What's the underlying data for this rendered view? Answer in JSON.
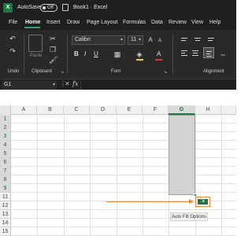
{
  "titlebar": {
    "app_letter": "X",
    "autosave_label": "AutoSave",
    "autosave_state": "Off",
    "document_title": "Book1 · Excel"
  },
  "tabs": [
    "File",
    "Home",
    "Insert",
    "Draw",
    "Page Layout",
    "Formulas",
    "Data",
    "Review",
    "View",
    "Help"
  ],
  "active_tab": "Home",
  "ribbon": {
    "groups": {
      "undo": "Undo",
      "clipboard": "Clipboard",
      "font": "Font",
      "alignment": "Alignment"
    },
    "paste_label": "Paste",
    "font_name": "Calibri",
    "font_size": "11",
    "bold": "B",
    "italic": "I",
    "underline": "U",
    "font_color_letter": "A",
    "highlight_color": "#f2d600",
    "font_color": "#e0352b",
    "accent": "#217346"
  },
  "name_box": "G1",
  "fx": "fx",
  "columns": [
    "A",
    "B",
    "C",
    "D",
    "E",
    "F",
    "G",
    "H"
  ],
  "selected_column": "G",
  "rows": [
    "1",
    "2",
    "3",
    "4",
    "5",
    "6",
    "7",
    "8",
    "9",
    "10",
    "11",
    "12",
    "13",
    "14",
    "15"
  ],
  "selected_rows": [
    "1",
    "2",
    "3",
    "4",
    "5",
    "6",
    "7",
    "8",
    "9",
    "10",
    "11"
  ],
  "autofill": {
    "tooltip": "Auto Fill Options",
    "arrow_color": "#e8893d"
  }
}
